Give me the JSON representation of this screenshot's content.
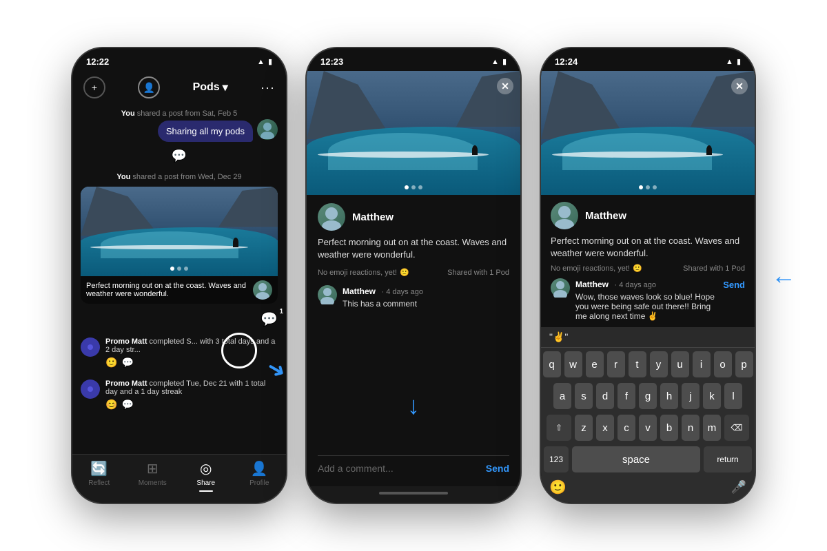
{
  "phone1": {
    "time": "12:22",
    "header": {
      "title": "Pods",
      "chevron": "▾"
    },
    "messages": [
      {
        "label": "You shared a post from Sat, Feb 5",
        "bubble": "Sharing all my pods"
      }
    ],
    "post": {
      "shared_label": "You shared a post from Wed, Dec 29",
      "text": "Perfect morning out on at the coast. Waves and weather were wonderful.",
      "comment_count": "1"
    },
    "activities": [
      {
        "user": "Promo Matt",
        "text": "completed S... with 3 total days and a 2 day str..."
      },
      {
        "user": "Promo Matt",
        "text": "completed Tue, Dec 21 with 1 total day and a 1 day streak"
      }
    ],
    "tabs": [
      "Reflect",
      "Moments",
      "Share",
      "Profile"
    ]
  },
  "phone2": {
    "time": "12:23",
    "author": "Matthew",
    "post_text": "Perfect morning out on at the coast. Waves and weather were wonderful.",
    "meta_left": "No emoji reactions, yet!",
    "meta_right": "Shared with 1 Pod",
    "comment": {
      "author": "Matthew",
      "time": "4 days ago",
      "text": "This has a comment"
    },
    "input_placeholder": "Add a comment...",
    "send": "Send"
  },
  "phone3": {
    "time": "12:24",
    "author": "Matthew",
    "post_text": "Perfect morning out on at the coast. Waves and weather were wonderful.",
    "meta_left": "No emoji reactions, yet!",
    "meta_right": "Shared with 1 Pod",
    "comment": {
      "author": "Matthew",
      "time": "4 days ago",
      "text": "Wow, those waves look so blue! Hope you were being safe out there!! Bring me along next time ✌️"
    },
    "send": "Send",
    "emoji_suggestion": "\"✌️\"",
    "keyboard_rows": [
      [
        "q",
        "w",
        "e",
        "r",
        "t",
        "y",
        "u",
        "i",
        "o",
        "p"
      ],
      [
        "a",
        "s",
        "d",
        "f",
        "g",
        "h",
        "j",
        "k",
        "l"
      ],
      [
        "z",
        "x",
        "c",
        "v",
        "b",
        "n",
        "m"
      ]
    ]
  }
}
